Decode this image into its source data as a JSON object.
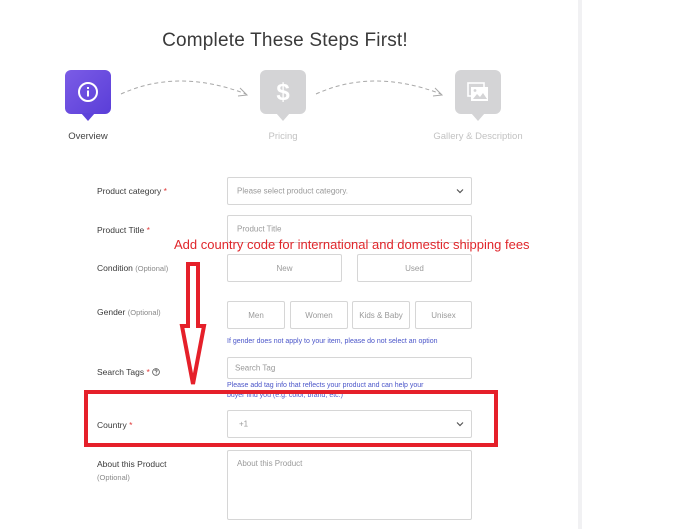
{
  "page_title": "Complete These Steps First!",
  "steps": [
    {
      "label": "Overview",
      "icon": "info-icon",
      "active": true
    },
    {
      "label": "Pricing",
      "icon": "dollar-icon",
      "active": false
    },
    {
      "label": "Gallery & Description",
      "icon": "gallery-icon",
      "active": false
    }
  ],
  "form": {
    "product_category": {
      "label": "Product category",
      "placeholder": "Please select product category."
    },
    "product_title": {
      "label": "Product Title",
      "placeholder": "Product Title"
    },
    "condition": {
      "label": "Condition",
      "optional": "(Optional)",
      "options": [
        "New",
        "Used"
      ]
    },
    "gender": {
      "label": "Gender",
      "optional": "(Optional)",
      "options": [
        "Men",
        "Women",
        "Kids & Baby",
        "Unisex"
      ],
      "hint": "If gender does not apply to your item, please do not select an option"
    },
    "search_tags": {
      "label": "Search Tags",
      "placeholder": "Search Tag",
      "hint_line1": "Please add tag info that reflects your product and can help your",
      "hint_line2": "buyer find you (e.g. color, brand, etc.)"
    },
    "country": {
      "label": "Country",
      "value": "+1"
    },
    "about": {
      "label": "About this Product",
      "optional": "(Optional)",
      "placeholder": "About this Product"
    },
    "required_mark": "*"
  },
  "annotation": {
    "text": "Add country code for international and domestic shipping fees",
    "color": "#e0262b"
  },
  "colors": {
    "accent": "#6a4ee0",
    "hint": "#4a55c9",
    "required": "#e03a3a"
  }
}
